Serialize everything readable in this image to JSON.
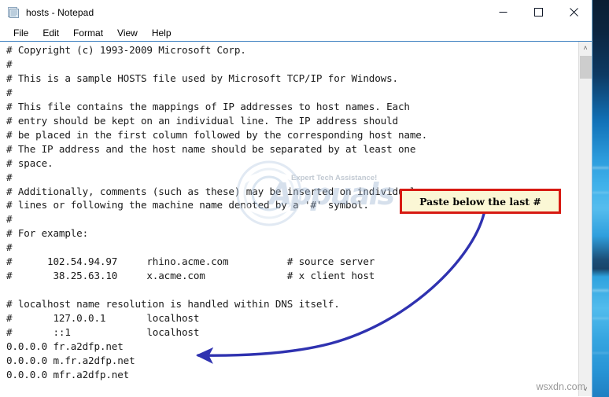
{
  "window": {
    "title": "hosts - Notepad",
    "icon": "notepad-icon",
    "controls": {
      "minimize": "Minimize",
      "maximize": "Maximize",
      "close": "Close"
    }
  },
  "menubar": {
    "items": [
      {
        "label": "File"
      },
      {
        "label": "Edit"
      },
      {
        "label": "Format"
      },
      {
        "label": "View"
      },
      {
        "label": "Help"
      }
    ]
  },
  "editor": {
    "content": "# Copyright (c) 1993-2009 Microsoft Corp.\n#\n# This is a sample HOSTS file used by Microsoft TCP/IP for Windows.\n#\n# This file contains the mappings of IP addresses to host names. Each\n# entry should be kept on an individual line. The IP address should\n# be placed in the first column followed by the corresponding host name.\n# The IP address and the host name should be separated by at least one\n# space.\n#\n# Additionally, comments (such as these) may be inserted on individual\n# lines or following the machine name denoted by a '#' symbol.\n#\n# For example:\n#\n#      102.54.94.97     rhino.acme.com          # source server\n#       38.25.63.10     x.acme.com              # x client host\n\n# localhost name resolution is handled within DNS itself.\n#       127.0.0.1       localhost\n#       ::1             localhost\n0.0.0.0 fr.a2dfp.net\n0.0.0.0 m.fr.a2dfp.net\n0.0.0.0 mfr.a2dfp.net"
  },
  "scrollbar": {
    "up_arrow": "˄",
    "down_arrow": "˅"
  },
  "annotation": {
    "callout_text": "Paste below the last #",
    "callout_border_color": "#d71a12",
    "callout_fill_color": "#fbf7d5",
    "arrow_color": "#2f32b0"
  },
  "watermarks": {
    "center_word": "Appuals",
    "center_tagline": "Expert Tech Assistance!",
    "corner": "wsxdn.com"
  }
}
